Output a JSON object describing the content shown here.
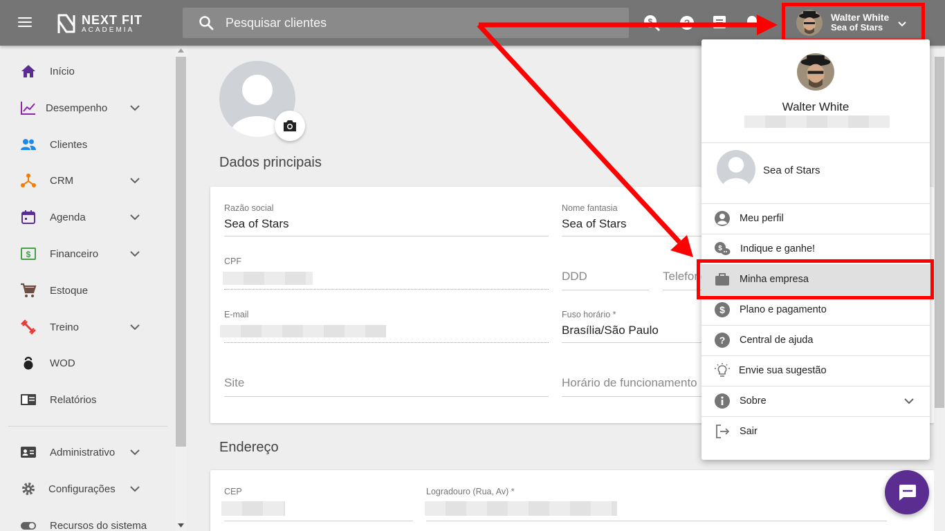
{
  "topbar": {
    "logo_line1": "NEXT FIT",
    "logo_line2": "ACADEMIA",
    "search_placeholder": "Pesquisar clientes",
    "user_name": "Walter White",
    "user_company": "Sea of Stars"
  },
  "sidebar": {
    "items": [
      {
        "label": "Início",
        "icon": "home-icon",
        "color": "#5c2d91"
      },
      {
        "label": "Desempenho",
        "icon": "chart-line-icon",
        "color": "#8e24aa"
      },
      {
        "label": "Clientes",
        "icon": "people-icon",
        "color": "#1e88e5"
      },
      {
        "label": "CRM",
        "icon": "crm-icon",
        "color": "#f57c00"
      },
      {
        "label": "Agenda",
        "icon": "calendar-icon",
        "color": "#5c2d91"
      },
      {
        "label": "Financeiro",
        "icon": "money-icon",
        "color": "#43a047"
      },
      {
        "label": "Estoque",
        "icon": "cart-icon",
        "color": "#6d4c41"
      },
      {
        "label": "Treino",
        "icon": "dumbbell-icon",
        "color": "#e53935"
      },
      {
        "label": "WOD",
        "icon": "kettlebell-icon",
        "color": "#212121"
      },
      {
        "label": "Relatórios",
        "icon": "report-icon",
        "color": "#424242"
      },
      {
        "label": "Administrativo",
        "icon": "id-card-icon",
        "color": "#424242"
      },
      {
        "label": "Configurações",
        "icon": "gear-icon",
        "color": "#616161"
      },
      {
        "label": "Recursos do sistema",
        "icon": "toggle-icon",
        "color": "#616161"
      }
    ]
  },
  "main": {
    "section1_title": "Dados principais",
    "section2_title": "Endereço",
    "fields": {
      "razao_label": "Razão social",
      "razao_value": "Sea of Stars",
      "fantasia_label": "Nome fantasia",
      "fantasia_value": "Sea of Stars",
      "cpf_label": "CPF",
      "ddd_placeholder": "DDD",
      "telefone_placeholder": "Telefone",
      "email_label": "E-mail",
      "fuso_label": "Fuso horário *",
      "fuso_value": "Brasília/São Paulo",
      "site_placeholder": "Site",
      "horario_placeholder": "Horário de funcionamento",
      "cep_label": "CEP",
      "logradouro_label": "Logradouro (Rua, Av) *"
    }
  },
  "dropdown": {
    "user_name": "Walter White",
    "company_name": "Sea of Stars",
    "items": [
      {
        "label": "Meu perfil",
        "icon": "account-circle-icon"
      },
      {
        "label": "Indique e ganhe!",
        "icon": "referral-chat-icon"
      },
      {
        "label": "Minha empresa",
        "icon": "briefcase-icon"
      },
      {
        "label": "Plano e pagamento",
        "icon": "dollar-circle-icon"
      },
      {
        "label": "Central de ajuda",
        "icon": "help-circle-icon"
      },
      {
        "label": "Envie sua sugestão",
        "icon": "lightbulb-icon"
      },
      {
        "label": "Sobre",
        "icon": "info-circle-icon"
      },
      {
        "label": "Sair",
        "icon": "logout-icon"
      }
    ]
  },
  "colors": {
    "topbar": "#757575",
    "highlight": "#ff0000",
    "chat": "#5c2d91"
  }
}
